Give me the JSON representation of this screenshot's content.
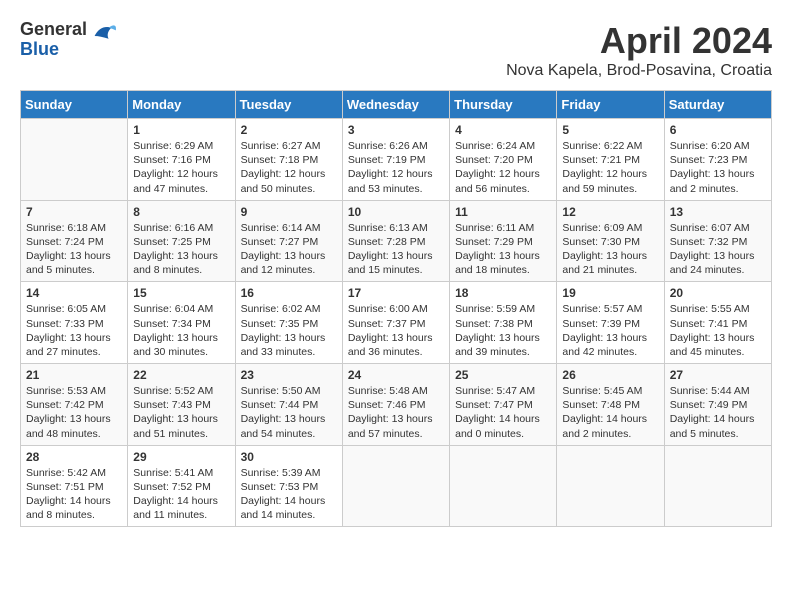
{
  "header": {
    "logo_general": "General",
    "logo_blue": "Blue",
    "month_title": "April 2024",
    "location": "Nova Kapela, Brod-Posavina, Croatia"
  },
  "days_of_week": [
    "Sunday",
    "Monday",
    "Tuesday",
    "Wednesday",
    "Thursday",
    "Friday",
    "Saturday"
  ],
  "weeks": [
    [
      {
        "day": "",
        "info": ""
      },
      {
        "day": "1",
        "info": "Sunrise: 6:29 AM\nSunset: 7:16 PM\nDaylight: 12 hours\nand 47 minutes."
      },
      {
        "day": "2",
        "info": "Sunrise: 6:27 AM\nSunset: 7:18 PM\nDaylight: 12 hours\nand 50 minutes."
      },
      {
        "day": "3",
        "info": "Sunrise: 6:26 AM\nSunset: 7:19 PM\nDaylight: 12 hours\nand 53 minutes."
      },
      {
        "day": "4",
        "info": "Sunrise: 6:24 AM\nSunset: 7:20 PM\nDaylight: 12 hours\nand 56 minutes."
      },
      {
        "day": "5",
        "info": "Sunrise: 6:22 AM\nSunset: 7:21 PM\nDaylight: 12 hours\nand 59 minutes."
      },
      {
        "day": "6",
        "info": "Sunrise: 6:20 AM\nSunset: 7:23 PM\nDaylight: 13 hours\nand 2 minutes."
      }
    ],
    [
      {
        "day": "7",
        "info": "Sunrise: 6:18 AM\nSunset: 7:24 PM\nDaylight: 13 hours\nand 5 minutes."
      },
      {
        "day": "8",
        "info": "Sunrise: 6:16 AM\nSunset: 7:25 PM\nDaylight: 13 hours\nand 8 minutes."
      },
      {
        "day": "9",
        "info": "Sunrise: 6:14 AM\nSunset: 7:27 PM\nDaylight: 13 hours\nand 12 minutes."
      },
      {
        "day": "10",
        "info": "Sunrise: 6:13 AM\nSunset: 7:28 PM\nDaylight: 13 hours\nand 15 minutes."
      },
      {
        "day": "11",
        "info": "Sunrise: 6:11 AM\nSunset: 7:29 PM\nDaylight: 13 hours\nand 18 minutes."
      },
      {
        "day": "12",
        "info": "Sunrise: 6:09 AM\nSunset: 7:30 PM\nDaylight: 13 hours\nand 21 minutes."
      },
      {
        "day": "13",
        "info": "Sunrise: 6:07 AM\nSunset: 7:32 PM\nDaylight: 13 hours\nand 24 minutes."
      }
    ],
    [
      {
        "day": "14",
        "info": "Sunrise: 6:05 AM\nSunset: 7:33 PM\nDaylight: 13 hours\nand 27 minutes."
      },
      {
        "day": "15",
        "info": "Sunrise: 6:04 AM\nSunset: 7:34 PM\nDaylight: 13 hours\nand 30 minutes."
      },
      {
        "day": "16",
        "info": "Sunrise: 6:02 AM\nSunset: 7:35 PM\nDaylight: 13 hours\nand 33 minutes."
      },
      {
        "day": "17",
        "info": "Sunrise: 6:00 AM\nSunset: 7:37 PM\nDaylight: 13 hours\nand 36 minutes."
      },
      {
        "day": "18",
        "info": "Sunrise: 5:59 AM\nSunset: 7:38 PM\nDaylight: 13 hours\nand 39 minutes."
      },
      {
        "day": "19",
        "info": "Sunrise: 5:57 AM\nSunset: 7:39 PM\nDaylight: 13 hours\nand 42 minutes."
      },
      {
        "day": "20",
        "info": "Sunrise: 5:55 AM\nSunset: 7:41 PM\nDaylight: 13 hours\nand 45 minutes."
      }
    ],
    [
      {
        "day": "21",
        "info": "Sunrise: 5:53 AM\nSunset: 7:42 PM\nDaylight: 13 hours\nand 48 minutes."
      },
      {
        "day": "22",
        "info": "Sunrise: 5:52 AM\nSunset: 7:43 PM\nDaylight: 13 hours\nand 51 minutes."
      },
      {
        "day": "23",
        "info": "Sunrise: 5:50 AM\nSunset: 7:44 PM\nDaylight: 13 hours\nand 54 minutes."
      },
      {
        "day": "24",
        "info": "Sunrise: 5:48 AM\nSunset: 7:46 PM\nDaylight: 13 hours\nand 57 minutes."
      },
      {
        "day": "25",
        "info": "Sunrise: 5:47 AM\nSunset: 7:47 PM\nDaylight: 14 hours\nand 0 minutes."
      },
      {
        "day": "26",
        "info": "Sunrise: 5:45 AM\nSunset: 7:48 PM\nDaylight: 14 hours\nand 2 minutes."
      },
      {
        "day": "27",
        "info": "Sunrise: 5:44 AM\nSunset: 7:49 PM\nDaylight: 14 hours\nand 5 minutes."
      }
    ],
    [
      {
        "day": "28",
        "info": "Sunrise: 5:42 AM\nSunset: 7:51 PM\nDaylight: 14 hours\nand 8 minutes."
      },
      {
        "day": "29",
        "info": "Sunrise: 5:41 AM\nSunset: 7:52 PM\nDaylight: 14 hours\nand 11 minutes."
      },
      {
        "day": "30",
        "info": "Sunrise: 5:39 AM\nSunset: 7:53 PM\nDaylight: 14 hours\nand 14 minutes."
      },
      {
        "day": "",
        "info": ""
      },
      {
        "day": "",
        "info": ""
      },
      {
        "day": "",
        "info": ""
      },
      {
        "day": "",
        "info": ""
      }
    ]
  ]
}
